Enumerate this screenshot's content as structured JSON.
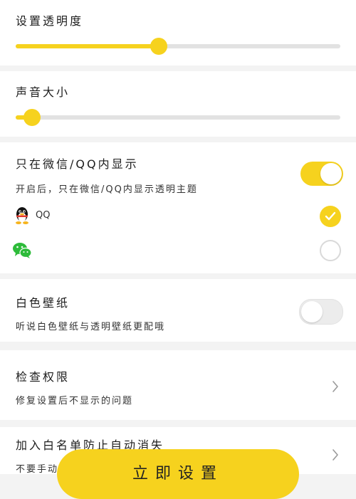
{
  "opacity": {
    "title": "设置透明度",
    "value": 0.44
  },
  "volume": {
    "title": "声音大小",
    "value": 0.05
  },
  "only_wechat_qq": {
    "title": "只在微信/QQ内显示",
    "description": "开启后，只在微信/QQ内显示透明主题",
    "enabled": true,
    "apps": [
      {
        "icon": "qq-penguin-icon",
        "label": "QQ",
        "checked": true
      },
      {
        "icon": "wechat-icon",
        "label": "",
        "checked": false
      }
    ]
  },
  "white_wallpaper": {
    "title": "白色壁纸",
    "description": "听说白色壁纸与透明壁纸更配哦",
    "enabled": false
  },
  "check_permissions": {
    "title": "检查权限",
    "description": "修复设置后不显示的问题"
  },
  "whitelist": {
    "title": "加入白名单防止自动消失",
    "description": "不要手动"
  },
  "apply_button": {
    "label": "立即设置"
  },
  "colors": {
    "accent": "#f6d21e",
    "track": "#e2e2e2",
    "background": "#f3f3f3"
  }
}
